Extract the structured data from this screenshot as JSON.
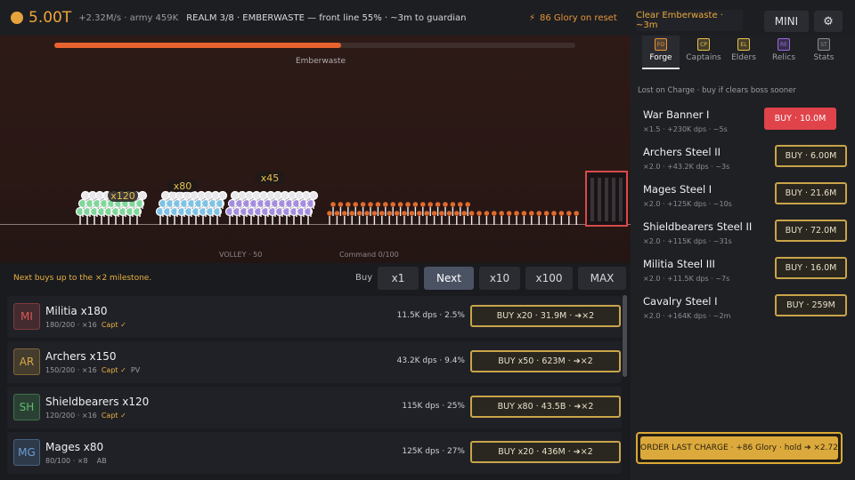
{
  "topbar": {
    "gold": "5.00T",
    "rate": "+2.32M/s · army 459K",
    "realm": "REALM 3/8 · EMBERWASTE — front line 55% · ~3m to guardian",
    "glory": "86 Glory on reset",
    "clear_label": "Clear Emberwaste · ~3m",
    "mini_label": "MINI",
    "gear_icon": "gear-icon"
  },
  "battle": {
    "progress": 0.55,
    "zone": "Emberwaste",
    "squads": [
      {
        "label": "x120",
        "color": "#7fd79a"
      },
      {
        "label": "x80",
        "color": "#7ec3e6"
      },
      {
        "label": "x45",
        "color": "#a58ee0"
      }
    ],
    "volley": "VOLLEY · 50",
    "command": "Command 0/100",
    "enemy_color": "#e06a2e",
    "gate_color": "#d64a4a"
  },
  "buy_bar": {
    "milestone": "Next buys up to the ×2 milestone.",
    "label": "Buy",
    "options": [
      "x1",
      "Next",
      "x10",
      "x100",
      "MAX"
    ],
    "active": "Next"
  },
  "units": [
    {
      "abbr": "MI",
      "name": "Militia  x180",
      "count": "180/200 · ×16",
      "capt": "Capt ✓",
      "extra": "",
      "dps": "11.5K dps · 2.5%",
      "button": "BUY x20 · 31.9M · ➔×2",
      "color": "#d95757"
    },
    {
      "abbr": "AR",
      "name": "Archers  x150",
      "count": "150/200 · ×16",
      "capt": "Capt ✓",
      "extra": "PV",
      "dps": "43.2K dps · 9.4%",
      "button": "BUY x50 · 623M · ➔×2",
      "color": "#d9a84a"
    },
    {
      "abbr": "SH",
      "name": "Shieldbearers  x120",
      "count": "120/200 · ×16",
      "capt": "Capt ✓",
      "extra": "",
      "dps": "115K dps · 25%",
      "button": "BUY x80 · 43.5B · ➔×2",
      "color": "#5bbf6e"
    },
    {
      "abbr": "MG",
      "name": "Mages  x80",
      "count": "80/100 · ×8",
      "capt": "",
      "extra": "AB",
      "dps": "125K dps · 27%",
      "button": "BUY x20 · 436M · ➔×2",
      "color": "#6a9ed6"
    }
  ],
  "sidebar": {
    "tabs": [
      {
        "abbr": "FO",
        "label": "Forge",
        "color": "#e8953a"
      },
      {
        "abbr": "CP",
        "label": "Captains",
        "color": "#e8c24a"
      },
      {
        "abbr": "EL",
        "label": "Elders",
        "color": "#e8c24a"
      },
      {
        "abbr": "RE",
        "label": "Relics",
        "color": "#9a6ae0"
      },
      {
        "abbr": "ST",
        "label": "Stats",
        "color": "#8a8a92"
      }
    ],
    "selected": "Forge",
    "note": "Lost on Charge · buy if clears boss sooner",
    "upgrades": [
      {
        "name": "War Banner I",
        "stats": "×1.5 · +230K dps · ~5s",
        "button": "BUY · 10.0M",
        "style": "red"
      },
      {
        "name": "Archers Steel II",
        "stats": "×2.0 · +43.2K dps · ~3s",
        "button": "BUY · 6.00M",
        "style": "gold"
      },
      {
        "name": "Mages Steel I",
        "stats": "×2.0 · +125K dps · ~10s",
        "button": "BUY · 21.6M",
        "style": "gold"
      },
      {
        "name": "Shieldbearers Steel II",
        "stats": "×2.0 · +115K dps · ~31s",
        "button": "BUY · 72.0M",
        "style": "gold"
      },
      {
        "name": "Militia Steel III",
        "stats": "×2.0 · +11.5K dps · ~7s",
        "button": "BUY · 16.0M",
        "style": "gold"
      },
      {
        "name": "Cavalry Steel I",
        "stats": "×2.0 · +164K dps · ~2m",
        "button": "BUY · 259M",
        "style": "gold"
      }
    ],
    "order_button": "ORDER LAST CHARGE · +86 Glory · hold ➔ ×2.72"
  }
}
